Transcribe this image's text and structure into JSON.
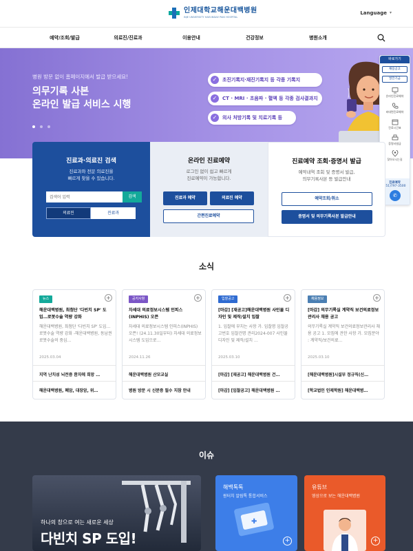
{
  "header": {
    "logo_kr": "인제대학교해운대백병원",
    "logo_en": "INJE UNIVERSITY HAEUNDAE PAIK HOSPITAL",
    "language": "Language",
    "menu": [
      "예약/조회/발급",
      "의료진/진료과",
      "이용안내",
      "건강정보",
      "병원소개"
    ]
  },
  "hero": {
    "small": "병원 방문 없이 홈페이지에서 발급 받으세요!",
    "title_line1": "의무기록 사본",
    "title_line2": "온라인 발급 서비스 시행",
    "pills": [
      "초진기록지·재진기록지 등 각종 기록지",
      "CT · MRI · 초음파 · 혈액 등 각종 검사결과지",
      "의사 처방기록 및 치료기록 등"
    ]
  },
  "quick": {
    "top": "바로가기",
    "btn1": "채용공고",
    "btn2": "발전기금",
    "items": [
      "온라인진료예약",
      "비대면진료예약",
      "진료시간표",
      "증명서발급",
      "찾아오시는길"
    ],
    "call_label": "진료예약",
    "call_number": "051)797-3500"
  },
  "services": {
    "s1": {
      "title": "진료과·의료진 검색",
      "desc1": "진료과와 전문 의료진을",
      "desc2": "빠르게 찾을 수 있습니다.",
      "search_placeholder": "검색어 입력",
      "search_btn": "검색",
      "tab1": "의료진",
      "tab2": "진료과"
    },
    "s2": {
      "title": "온라인 진료예약",
      "desc1": "로그인 없이 쉽고 빠르게",
      "desc2": "진료예약이 가능합니다.",
      "btn1": "진료과 예약",
      "btn2": "의료진 예약",
      "btn3": "간편진료예약"
    },
    "s3": {
      "title": "진료예약 조회·증명서 발급",
      "desc1": "예약내역 조회 및 증명서 발급,",
      "desc2": "의무기록사본 등 발급안내",
      "btn1": "예약조회/취소",
      "btn2": "증명서 및 의무기록사본 발급안내"
    }
  },
  "news": {
    "title": "소식",
    "cards": [
      {
        "badge": "뉴스",
        "title": "해운대백병원, 최첨단 '다빈치 SP' 도입…로봇수술 역량 강화",
        "body": "해운대백병원, 최첨단 '다빈치 SP' 도입…로봇수술 역량 강화 -해운대백병원, 동남권 로봇수술의 중심…",
        "date": "2025.03.04",
        "sub1": "지역 난치성 뇌전증 환자에 희망 …",
        "sub2": "해운대백병원, 폐암, 대장암, 위…"
      },
      {
        "badge": "공지사항",
        "title": "차세대 의료정보시스템 인피스(INPHIS) 오픈",
        "body": "차세대 의료정보시스템 인피스(INPHIS) 오픈! (24.11.30일부터) 차세대 의료정보시스템 도입으로…",
        "date": "2024.11.26",
        "sub1": "해운대백병원 산모교실",
        "sub2": "병원 방문 시 신분증 필수 지참 안내"
      },
      {
        "badge": "입찰공고",
        "title": "[마감] [재공고]해운대백병원 사인물 디자인 및 제작/설치 입찰",
        "body": "1. 입찰에 부치는 사항 가. 입찰명 입찰공고번호 입찰건명 관리2024-007 사인물 디자인 및 제작/설치 …",
        "date": "2025.03.10",
        "sub1": "[마감] [재공고] 해운대백병원 건…",
        "sub2": "[마감] [입찰공고] 해운대백병원 …"
      },
      {
        "badge": "채용정보",
        "title": "[마감] 의무기록실 계약직 보건의료정보관리사 채용 공고",
        "body": "의무기록실 계약직 보건의료정보관리사 채용 공고 1. 모집에 관한 사항 가. 모집분야 : 계약직/보건의료…",
        "date": "2025.03.10",
        "sub1": "[해운대백병원]시설부 정규직(신…",
        "sub2": "[학교법인 인제학원] 해운대백병…"
      }
    ]
  },
  "issue": {
    "title": "이슈",
    "card1_sub": "하나의 창으로 여는 새로운 세상",
    "card1_big": "다빈치 SP 도입!",
    "card2_title": "해백톡톡",
    "card2_sub": "원터치 알림톡 통합서비스",
    "card3_title": "유튜브",
    "card3_sub": "영상으로 보는 해운대백병원"
  },
  "colors": {
    "brand_blue": "#1d4f9d",
    "teal": "#13a99a",
    "hero_purple": "#8571d3",
    "badge_news": "#13a99a",
    "badge_notice": "#7b56c6",
    "badge_bid": "#2f6bd1",
    "badge_job": "#4b7fb3"
  }
}
